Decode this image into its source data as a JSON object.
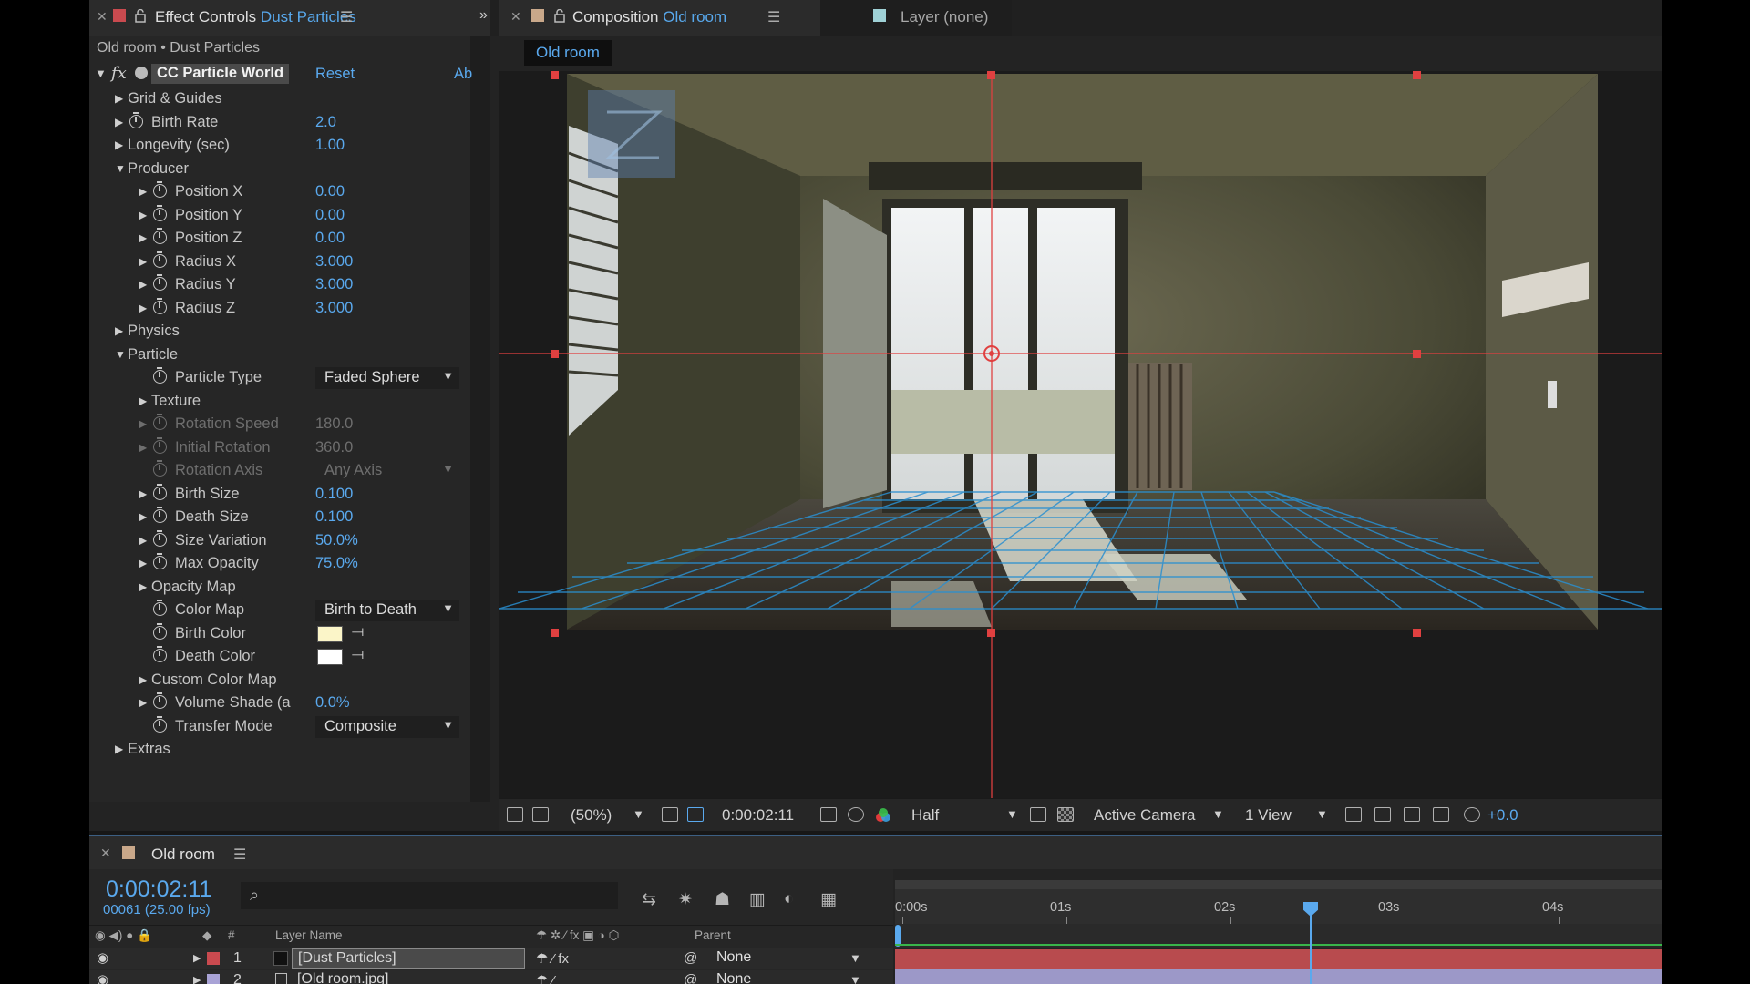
{
  "effect_controls": {
    "tab_label": "Effect Controls",
    "tab_layer": "Dust Particles",
    "header": "Old room • Dust Particles",
    "effect_name": "CC Particle World",
    "reset": "Reset",
    "about": "Ab",
    "rows": [
      {
        "label": "Grid & Guides",
        "level": 1,
        "tri": "▶",
        "stopwatch": false,
        "value": ""
      },
      {
        "label": "Birth Rate",
        "level": 1,
        "tri": "▶",
        "stopwatch": true,
        "value": "2.0"
      },
      {
        "label": "Longevity (sec)",
        "level": 1,
        "tri": "▶",
        "stopwatch": false,
        "value": "1.00"
      },
      {
        "label": "Producer",
        "level": 1,
        "tri": "▼",
        "stopwatch": false,
        "value": ""
      },
      {
        "label": "Position X",
        "level": 2,
        "tri": "▶",
        "stopwatch": true,
        "value": "0.00"
      },
      {
        "label": "Position Y",
        "level": 2,
        "tri": "▶",
        "stopwatch": true,
        "value": "0.00"
      },
      {
        "label": "Position Z",
        "level": 2,
        "tri": "▶",
        "stopwatch": true,
        "value": "0.00"
      },
      {
        "label": "Radius X",
        "level": 2,
        "tri": "▶",
        "stopwatch": true,
        "value": "3.000"
      },
      {
        "label": "Radius Y",
        "level": 2,
        "tri": "▶",
        "stopwatch": true,
        "value": "3.000"
      },
      {
        "label": "Radius Z",
        "level": 2,
        "tri": "▶",
        "stopwatch": true,
        "value": "3.000"
      },
      {
        "label": "Physics",
        "level": 1,
        "tri": "▶",
        "stopwatch": false,
        "value": ""
      },
      {
        "label": "Particle",
        "level": 1,
        "tri": "▼",
        "stopwatch": false,
        "value": ""
      },
      {
        "label": "Particle Type",
        "level": 2,
        "tri": "",
        "stopwatch": true,
        "dropdown": "Faded Sphere"
      },
      {
        "label": "Texture",
        "level": 2,
        "tri": "▶",
        "stopwatch": false,
        "value": ""
      },
      {
        "label": "Rotation Speed",
        "level": 2,
        "tri": "▶",
        "stopwatch": true,
        "value": "180.0",
        "dim": true
      },
      {
        "label": "Initial Rotation",
        "level": 2,
        "tri": "▶",
        "stopwatch": true,
        "value": "360.0",
        "dim": true
      },
      {
        "label": "Rotation Axis",
        "level": 2,
        "tri": "",
        "stopwatch": true,
        "dropdown": "Any Axis",
        "dim": true
      },
      {
        "label": "Birth Size",
        "level": 2,
        "tri": "▶",
        "stopwatch": true,
        "value": "0.100"
      },
      {
        "label": "Death Size",
        "level": 2,
        "tri": "▶",
        "stopwatch": true,
        "value": "0.100"
      },
      {
        "label": "Size Variation",
        "level": 2,
        "tri": "▶",
        "stopwatch": true,
        "value": "50.0%"
      },
      {
        "label": "Max Opacity",
        "level": 2,
        "tri": "▶",
        "stopwatch": true,
        "value": "75.0%"
      },
      {
        "label": "Opacity Map",
        "level": 2,
        "tri": "▶",
        "stopwatch": false,
        "value": ""
      },
      {
        "label": "Color Map",
        "level": 2,
        "tri": "",
        "stopwatch": true,
        "dropdown": "Birth to Death"
      },
      {
        "label": "Birth Color",
        "level": 2,
        "tri": "",
        "stopwatch": true,
        "color": "#fbf5c8"
      },
      {
        "label": "Death Color",
        "level": 2,
        "tri": "",
        "stopwatch": true,
        "color": "#ffffff"
      },
      {
        "label": "Custom Color Map",
        "level": 2,
        "tri": "▶",
        "stopwatch": false,
        "value": ""
      },
      {
        "label": "Volume Shade (a",
        "level": 2,
        "tri": "▶",
        "stopwatch": true,
        "value": "0.0%"
      },
      {
        "label": "Transfer Mode",
        "level": 2,
        "tri": "",
        "stopwatch": true,
        "dropdown": "Composite"
      },
      {
        "label": "Extras",
        "level": 1,
        "tri": "▶",
        "stopwatch": false,
        "value": ""
      }
    ]
  },
  "composition": {
    "tab_label": "Composition",
    "tab_comp": "Old room",
    "layer_tab": "Layer (none)",
    "breadcrumb": "Old room",
    "footer": {
      "zoom": "(50%)",
      "timecode": "0:00:02:11",
      "resolution": "Half",
      "camera": "Active Camera",
      "views": "1 View",
      "exposure": "+0.0"
    }
  },
  "timeline": {
    "tab_label": "Old room",
    "timecode": "0:00:02:11",
    "frames": "00061 (25.00 fps)",
    "columns": {
      "hash": "#",
      "layer_name": "Layer Name",
      "parent": "Parent"
    },
    "ruler_ticks": [
      "0:00s",
      "01s",
      "02s",
      "03s",
      "04s"
    ],
    "layers": [
      {
        "num": "1",
        "name": "[Dust Particles]",
        "parent": "None",
        "color": "#c94a4f"
      },
      {
        "num": "2",
        "name": "[Old room.jpg]",
        "parent": "None",
        "color": "#a9a3d6"
      }
    ]
  },
  "colors": {
    "accent": "#5aa9ee",
    "guide_red": "#e04040",
    "grid_blue": "#2a8fd0"
  }
}
